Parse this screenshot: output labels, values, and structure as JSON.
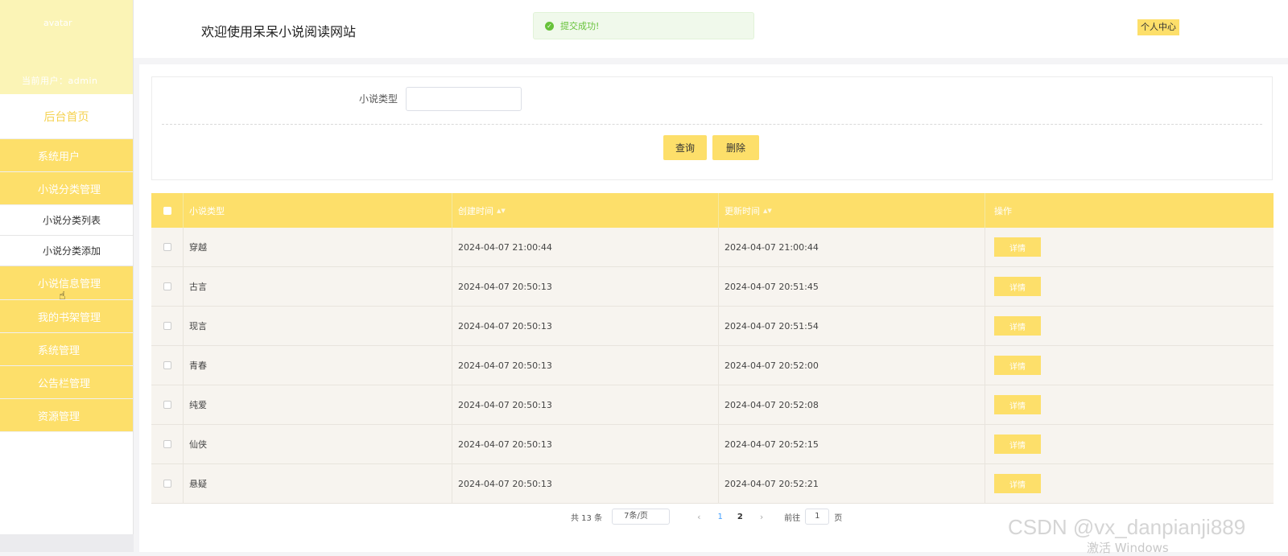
{
  "sidebar": {
    "avatar_alt": "avatar",
    "current_user": "当前用户：admin",
    "home": "后台首页",
    "menu": [
      {
        "label": "系统用户"
      },
      {
        "label": "小说分类管理"
      },
      {
        "label": "小说分类列表"
      },
      {
        "label": "小说分类添加"
      },
      {
        "label": "小说信息管理"
      },
      {
        "label": "我的书架管理"
      },
      {
        "label": "系统管理"
      },
      {
        "label": "公告栏管理"
      },
      {
        "label": "资源管理"
      }
    ]
  },
  "header": {
    "title": "欢迎使用呆呆小说阅读网站",
    "toast": "提交成功!",
    "profile": "个人中心"
  },
  "search": {
    "label": "小说类型",
    "value": "",
    "query_btn": "查询",
    "delete_btn": "删除"
  },
  "table": {
    "headers": [
      "小说类型",
      "创建时间",
      "更新时间",
      "操作"
    ],
    "detail_label": "详情",
    "rows": [
      {
        "type": "穿越",
        "created": "2024-04-07 21:00:44",
        "updated": "2024-04-07 21:00:44"
      },
      {
        "type": "古言",
        "created": "2024-04-07 20:50:13",
        "updated": "2024-04-07 20:51:45"
      },
      {
        "type": "现言",
        "created": "2024-04-07 20:50:13",
        "updated": "2024-04-07 20:51:54"
      },
      {
        "type": "青春",
        "created": "2024-04-07 20:50:13",
        "updated": "2024-04-07 20:52:00"
      },
      {
        "type": "纯爱",
        "created": "2024-04-07 20:50:13",
        "updated": "2024-04-07 20:52:08"
      },
      {
        "type": "仙侠",
        "created": "2024-04-07 20:50:13",
        "updated": "2024-04-07 20:52:15"
      },
      {
        "type": "悬疑",
        "created": "2024-04-07 20:50:13",
        "updated": "2024-04-07 20:52:21"
      }
    ]
  },
  "pagination": {
    "total": "共 13 条",
    "page_size": "7条/页",
    "prev": "‹",
    "pages": [
      "1",
      "2"
    ],
    "next": "›",
    "goto_label": "前往",
    "goto_value": "1",
    "goto_suffix": "页"
  },
  "overlay": {
    "watermark": "CSDN @vx_danpianji889",
    "activate": "激活 Windows"
  },
  "colors": {
    "accent": "#fddf6a",
    "sidebar_head": "#fbf4b6",
    "success": "#67c23a"
  }
}
